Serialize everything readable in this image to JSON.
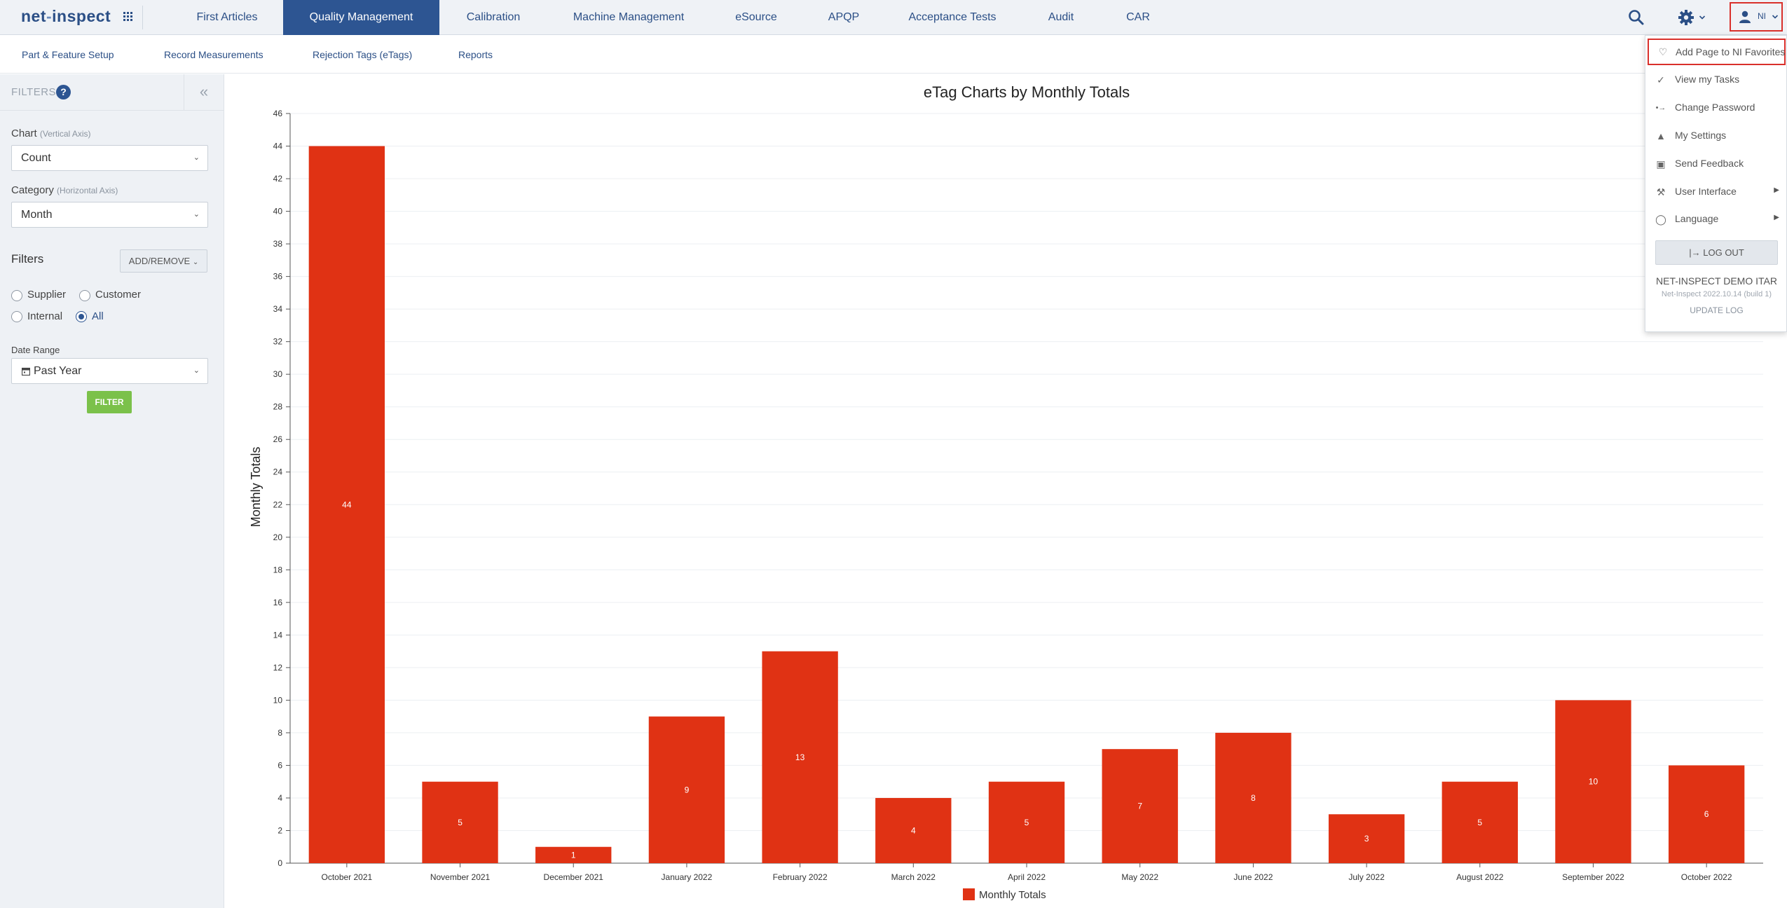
{
  "app": {
    "logo_text_left": "net",
    "logo_text_dash": "-",
    "logo_text_right": "inspect"
  },
  "topnav": {
    "items": [
      {
        "label": "First Articles",
        "active": false
      },
      {
        "label": "Quality Management",
        "active": true
      },
      {
        "label": "Calibration",
        "active": false
      },
      {
        "label": "Machine Management",
        "active": false
      },
      {
        "label": "eSource",
        "active": false
      },
      {
        "label": "APQP",
        "active": false
      },
      {
        "label": "Acceptance Tests",
        "active": false
      },
      {
        "label": "Audit",
        "active": false
      },
      {
        "label": "CAR",
        "active": false
      }
    ],
    "user_initials": "NI",
    "active_color": "#2d5592"
  },
  "subnav": {
    "items": [
      {
        "label": "Part & Feature Setup"
      },
      {
        "label": "Record Measurements"
      },
      {
        "label": "Rejection Tags (eTags)"
      },
      {
        "label": "Reports"
      }
    ]
  },
  "sidebar": {
    "title": "FILTERS",
    "help_symbol": "?",
    "collapse_symbol": "«",
    "chart_label": "Chart",
    "chart_hint": "(Vertical Axis)",
    "chart_value": "Count",
    "category_label": "Category",
    "category_hint": "(Horizontal Axis)",
    "category_value": "Month",
    "filters_label": "Filters",
    "add_remove_label": "ADD/REMOVE",
    "radios": [
      {
        "label": "Supplier",
        "checked": false
      },
      {
        "label": "Customer",
        "checked": false
      },
      {
        "label": "Internal",
        "checked": false
      },
      {
        "label": "All",
        "checked": true
      }
    ],
    "date_range_label": "Date Range",
    "date_range_value": "Past Year",
    "filter_button": "FILTER",
    "filter_button_color": "#7bc14a"
  },
  "user_menu": {
    "items": [
      {
        "label": "Add Page to NI Favorites",
        "icon": "heart-icon",
        "submenu": false
      },
      {
        "label": "View my Tasks",
        "icon": "check-icon",
        "submenu": false
      },
      {
        "label": "Change Password",
        "icon": "key-icon",
        "submenu": false
      },
      {
        "label": "My Settings",
        "icon": "bell-icon",
        "submenu": false
      },
      {
        "label": "Send Feedback",
        "icon": "inbox-icon",
        "submenu": false
      },
      {
        "label": "User Interface",
        "icon": "wrench-icon",
        "submenu": true
      },
      {
        "label": "Language",
        "icon": "globe-icon",
        "submenu": true
      }
    ],
    "logout_label": "LOG OUT",
    "company": "NET-INSPECT DEMO ITAR",
    "version": "Net-Inspect 2022.10.14 (build 1)",
    "update_log": "UPDATE LOG",
    "highlight_color": "#d9302b"
  },
  "chart_data": {
    "type": "bar",
    "title": "eTag Charts by Monthly Totals",
    "xlabel": "",
    "ylabel": "Monthly Totals",
    "ylim": [
      0,
      46
    ],
    "ytick_step": 2,
    "categories": [
      "October 2021",
      "November 2021",
      "December 2021",
      "January 2022",
      "February 2022",
      "March 2022",
      "April 2022",
      "May 2022",
      "June 2022",
      "July 2022",
      "August 2022",
      "September 2022",
      "October 2022"
    ],
    "series": [
      {
        "name": "Monthly Totals",
        "values": [
          44,
          5,
          1,
          9,
          13,
          4,
          5,
          7,
          8,
          3,
          5,
          10,
          6
        ],
        "color": "#e03214"
      }
    ],
    "grid": true,
    "legend": "bottom-center"
  }
}
